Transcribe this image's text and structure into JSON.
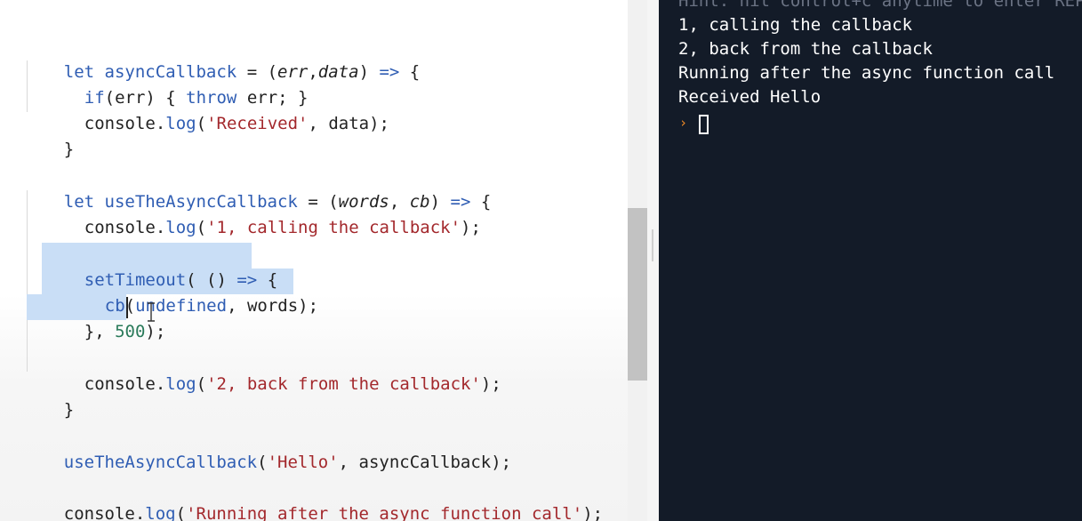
{
  "editor": {
    "line1": {
      "kw": "let",
      "name": " asyncCallback",
      "eq": " = (",
      "p1": "err",
      "comma": ",",
      "p2": "data",
      "close": ") ",
      "arrow": "=>",
      "brace": " {"
    },
    "line2": {
      "kw": "if",
      "a": "(err) { ",
      "throw": "throw",
      "b": " err; }"
    },
    "line3": {
      "obj": "console.",
      "fn": "log",
      "open": "(",
      "str": "'Received'",
      "rest": ", data);"
    },
    "line4": {
      "text": "}"
    },
    "line5": {
      "kw": "let",
      "name": " useTheAsyncCallback",
      "eq": " = (",
      "p1": "words",
      "comma": ", ",
      "p2": "cb",
      "close": ") ",
      "arrow": "=>",
      "brace": " {"
    },
    "line6": {
      "obj": "console.",
      "fn": "log",
      "open": "(",
      "str": "'1, calling the callback'",
      "rest": ");"
    },
    "line7": {
      "fn": "setTimeout",
      "a": "( () ",
      "arrow": "=>",
      "b": " {"
    },
    "line8": {
      "fn": "cb",
      "a": "(",
      "undef": "undefined",
      "b": ", words);"
    },
    "line9": {
      "a": "}, ",
      "num": "500",
      "b": ");"
    },
    "line10": {
      "obj": "console.",
      "fn": "log",
      "open": "(",
      "str": "'2, back from the callback'",
      "rest": ");"
    },
    "line11": {
      "text": "}"
    },
    "line12": {
      "fn": "useTheAsyncCallback",
      "open": "(",
      "str": "'Hello'",
      "rest": ", asyncCallback);"
    },
    "line13": {
      "obj": "console.",
      "fn": "log",
      "open": "(",
      "str": "'Running after the async function call'",
      "rest": ");"
    }
  },
  "terminal": {
    "hint": "Hint: hit control+c anytime to enter REPL.",
    "output": [
      "1, calling the callback",
      "2, back from the callback",
      "Running after the async function call",
      "Received Hello"
    ],
    "prompt_symbol": "›"
  },
  "colors": {
    "keyword": "#2f5db3",
    "string": "#a3282c",
    "number": "#2a7a5a",
    "selection": "#c9def6",
    "terminal_bg": "#131b28",
    "prompt": "#f08a24"
  }
}
